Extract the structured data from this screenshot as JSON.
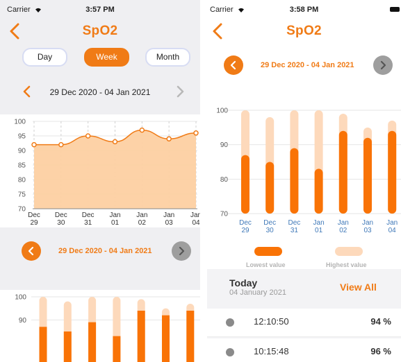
{
  "left": {
    "status": {
      "carrier": "Carrier",
      "time": "3:57 PM"
    },
    "title": "SpO2",
    "segments": [
      {
        "label": "Day",
        "active": false
      },
      {
        "label": "Week",
        "active": true
      },
      {
        "label": "Month",
        "active": false
      }
    ],
    "range_label": "29 Dec 2020 - 04 Jan 2021",
    "range_label_2": "29 Dec 2020 - 04 Jan 2021"
  },
  "right": {
    "status": {
      "carrier": "Carrier",
      "time": "3:58 PM"
    },
    "title": "SpO2",
    "range_label": "29 Dec 2020 - 04 Jan 2021",
    "legend": {
      "low": "Lowest value",
      "high": "Highest value"
    },
    "today": {
      "title": "Today",
      "date": "04 January 2021",
      "view_all": "View All"
    },
    "readings": [
      {
        "time": "12:10:50",
        "value": "94 %"
      },
      {
        "time": "10:15:48",
        "value": "96 %"
      }
    ]
  },
  "colors": {
    "accent": "#f07b16",
    "area_fill": "#fdd0a2",
    "bar_light": "#fdd9bb",
    "bar_dark": "#f97306",
    "nav_gray": "#9e9e9e"
  },
  "chart_data": [
    {
      "type": "area",
      "categories": [
        [
          "Dec",
          "29"
        ],
        [
          "Dec",
          "30"
        ],
        [
          "Dec",
          "31"
        ],
        [
          "Jan",
          "01"
        ],
        [
          "Jan",
          "02"
        ],
        [
          "Jan",
          "03"
        ],
        [
          "Jan",
          "04"
        ]
      ],
      "values": [
        92,
        92,
        95,
        93,
        97,
        94,
        96
      ],
      "ylim": [
        70,
        100
      ],
      "yticks": [
        70,
        75,
        80,
        85,
        90,
        95,
        100
      ]
    },
    {
      "type": "bar",
      "series": [
        {
          "name": "Lowest value",
          "values": [
            87,
            85,
            89,
            83,
            94,
            92,
            94
          ]
        },
        {
          "name": "Highest value",
          "values": [
            100,
            98,
            100,
            100,
            99,
            95,
            97
          ]
        }
      ],
      "ylim": [
        70,
        100
      ],
      "yticks": [
        90,
        100
      ]
    },
    {
      "type": "bar",
      "categories": [
        [
          "Dec",
          "29"
        ],
        [
          "Dec",
          "30"
        ],
        [
          "Dec",
          "31"
        ],
        [
          "Jan",
          "01"
        ],
        [
          "Jan",
          "02"
        ],
        [
          "Jan",
          "03"
        ],
        [
          "Jan",
          "04"
        ]
      ],
      "series": [
        {
          "name": "Lowest value",
          "values": [
            87,
            85,
            89,
            83,
            94,
            92,
            94
          ]
        },
        {
          "name": "Highest value",
          "values": [
            100,
            98,
            100,
            100,
            99,
            95,
            97
          ]
        }
      ],
      "ylim": [
        70,
        100
      ],
      "yticks": [
        70,
        80,
        90,
        100
      ]
    }
  ]
}
